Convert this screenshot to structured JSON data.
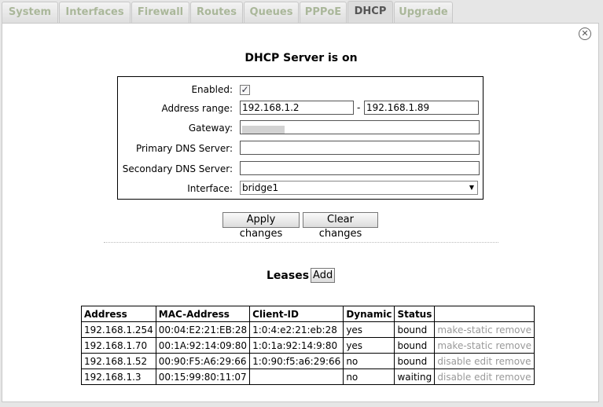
{
  "tabs": [
    {
      "label": "System",
      "active": false
    },
    {
      "label": "Interfaces",
      "active": false
    },
    {
      "label": "Firewall",
      "active": false
    },
    {
      "label": "Routes",
      "active": false
    },
    {
      "label": "Queues",
      "active": false
    },
    {
      "label": "PPPoE",
      "active": false
    },
    {
      "label": "DHCP",
      "active": true
    },
    {
      "label": "Upgrade",
      "active": false
    }
  ],
  "close_symbol": "✕",
  "title": "DHCP Server is on",
  "form": {
    "enabled_label": "Enabled:",
    "enabled_check": "✓",
    "address_range_label": "Address range:",
    "range_start": "192.168.1.2",
    "range_sep": "-",
    "range_end": "192.168.1.89",
    "gateway_label": "Gateway:",
    "primary_dns_label": "Primary DNS Server:",
    "primary_dns": "",
    "secondary_dns_label": "Secondary DNS Server:",
    "secondary_dns": "",
    "interface_label": "Interface:",
    "interface_value": "bridge1"
  },
  "buttons": {
    "apply": "Apply changes",
    "clear": "Clear changes"
  },
  "leases": {
    "title": "Leases",
    "add_label": "Add",
    "columns": [
      "Address",
      "MAC-Address",
      "Client-ID",
      "Dynamic",
      "Status"
    ],
    "rows": [
      {
        "address": "192.168.1.254",
        "mac": "00:04:E2:21:EB:28",
        "client_id": "1:0:4:e2:21:eb:28",
        "dynamic": "yes",
        "status": "bound",
        "a1": "make-static",
        "a2": "remove",
        "a3": ""
      },
      {
        "address": "192.168.1.70",
        "mac": "00:1A:92:14:09:80",
        "client_id": "1:0:1a:92:14:9:80",
        "dynamic": "yes",
        "status": "bound",
        "a1": "make-static",
        "a2": "remove",
        "a3": ""
      },
      {
        "address": "192.168.1.52",
        "mac": "00:90:F5:A6:29:66",
        "client_id": "1:0:90:f5:a6:29:66",
        "dynamic": "no",
        "status": "bound",
        "a1": "disable",
        "a2": "edit",
        "a3": "remove"
      },
      {
        "address": "192.168.1.3",
        "mac": "00:15:99:80:11:07",
        "client_id": "",
        "dynamic": "no",
        "status": "waiting",
        "a1": "disable",
        "a2": "edit",
        "a3": "remove"
      }
    ]
  }
}
